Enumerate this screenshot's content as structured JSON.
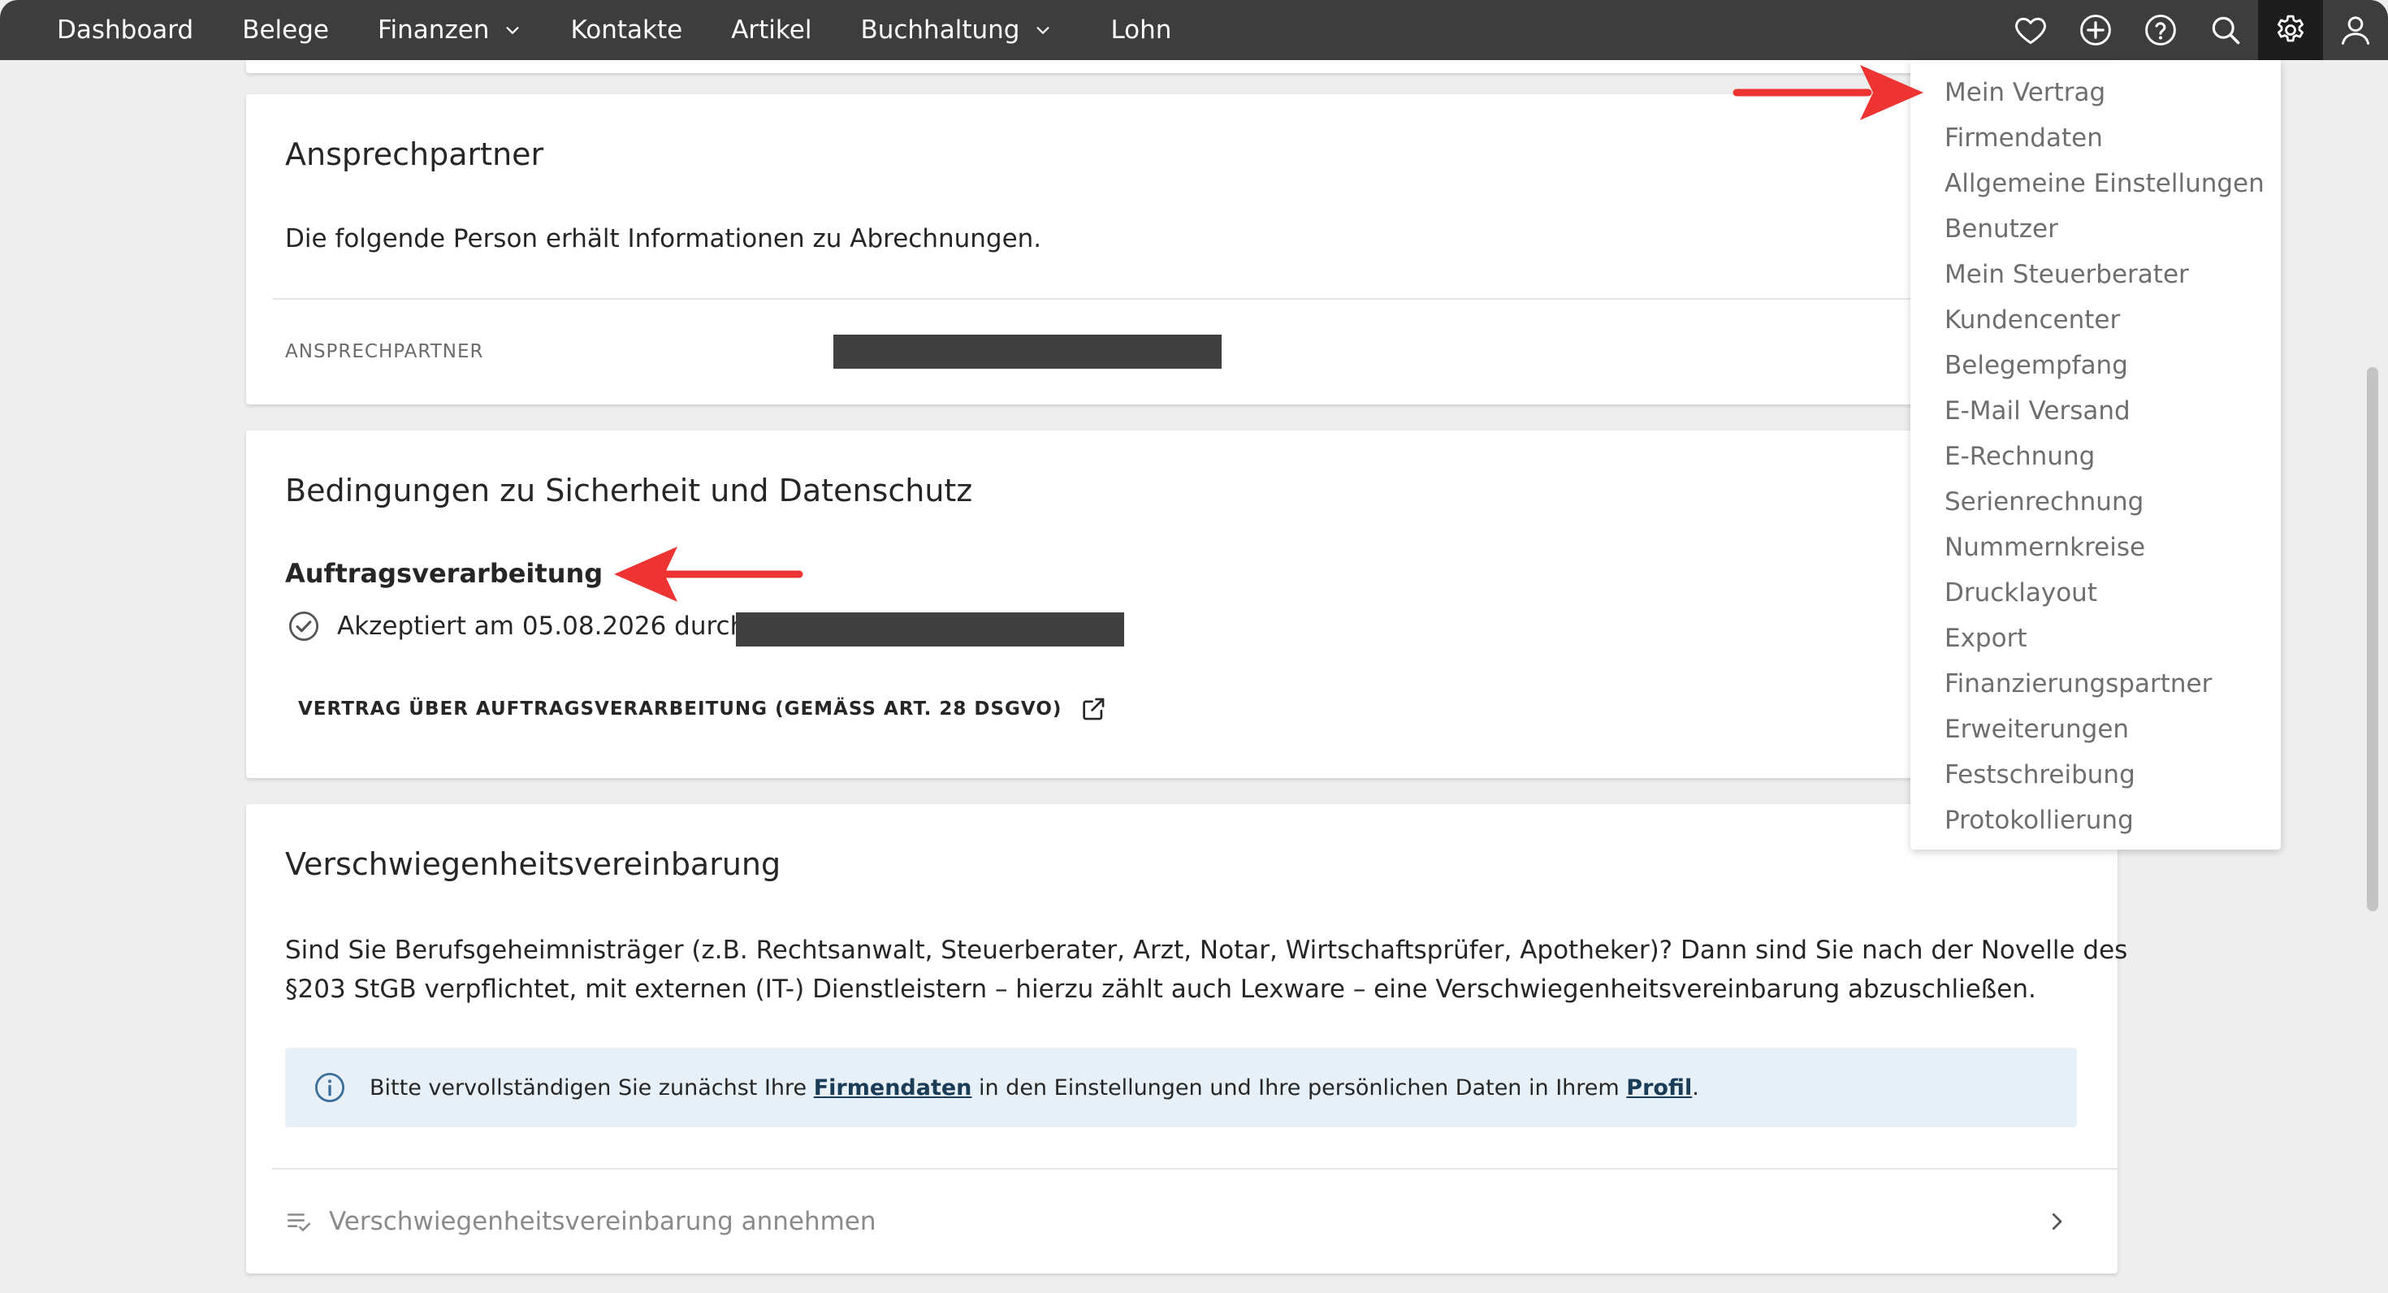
{
  "nav": {
    "items": [
      {
        "label": "Dashboard",
        "dropdown": false
      },
      {
        "label": "Belege",
        "dropdown": false
      },
      {
        "label": "Finanzen",
        "dropdown": true
      },
      {
        "label": "Kontakte",
        "dropdown": false
      },
      {
        "label": "Artikel",
        "dropdown": false
      },
      {
        "label": "Buchhaltung",
        "dropdown": true
      },
      {
        "label": "Lohn",
        "dropdown": false
      }
    ],
    "icons": [
      "heart-icon",
      "plus-circle-icon",
      "help-icon",
      "search-icon",
      "gear-icon",
      "user-icon"
    ]
  },
  "contact_card": {
    "title": "Ansprechpartner",
    "description": "Die folgende Person erhält Informationen zu Abrechnungen.",
    "field_label": "ANSPRECHPARTNER"
  },
  "security_card": {
    "title": "Bedingungen zu Sicherheit und Datenschutz",
    "subheading": "Auftragsverarbeitung",
    "accepted_text": "Akzeptiert am 05.08.2026 durch",
    "contract_link": "VERTRAG ÜBER AUFTRAGSVERARBEITUNG (GEMÄSS ART. 28 DSGVO)"
  },
  "nda_card": {
    "title": "Verschwiegenheitsvereinbarung",
    "paragraph_line1": "Sind Sie Berufsgeheimnisträger (z.B. Rechtsanwalt, Steuerberater, Arzt, Notar, Wirtschaftsprüfer, Apotheker)? Dann sind Sie nach der Novelle des",
    "paragraph_line2": "§203 StGB verpflichtet, mit externen (IT-) Dienstleistern – hierzu zählt auch Lexware – eine Verschwiegenheitsvereinbarung abzuschließen.",
    "info": {
      "prefix": "Bitte vervollständigen Sie zunächst Ihre ",
      "link1": "Firmendaten",
      "middle": " in den Einstellungen und Ihre persönlichen Daten in Ihrem ",
      "link2": "Profil",
      "suffix": "."
    },
    "accept_action": "Verschwiegenheitsvereinbarung annehmen"
  },
  "settings_menu": {
    "items": [
      "Mein Vertrag",
      "Firmendaten",
      "Allgemeine Einstellungen",
      "Benutzer",
      "Mein Steuerberater",
      "Kundencenter",
      "Belegempfang",
      "E-Mail Versand",
      "E-Rechnung",
      "Serienrechnung",
      "Nummernkreise",
      "Drucklayout",
      "Export",
      "Finanzierungspartner",
      "Erweiterungen",
      "Festschreibung",
      "Protokollierung"
    ]
  },
  "colors": {
    "topbar": "#3d3d3d",
    "active_icon_bg": "#1d1d1d",
    "info_bg": "#e7f0f7",
    "link": "#1b3c56",
    "annotation_arrow": "#ee3333"
  }
}
